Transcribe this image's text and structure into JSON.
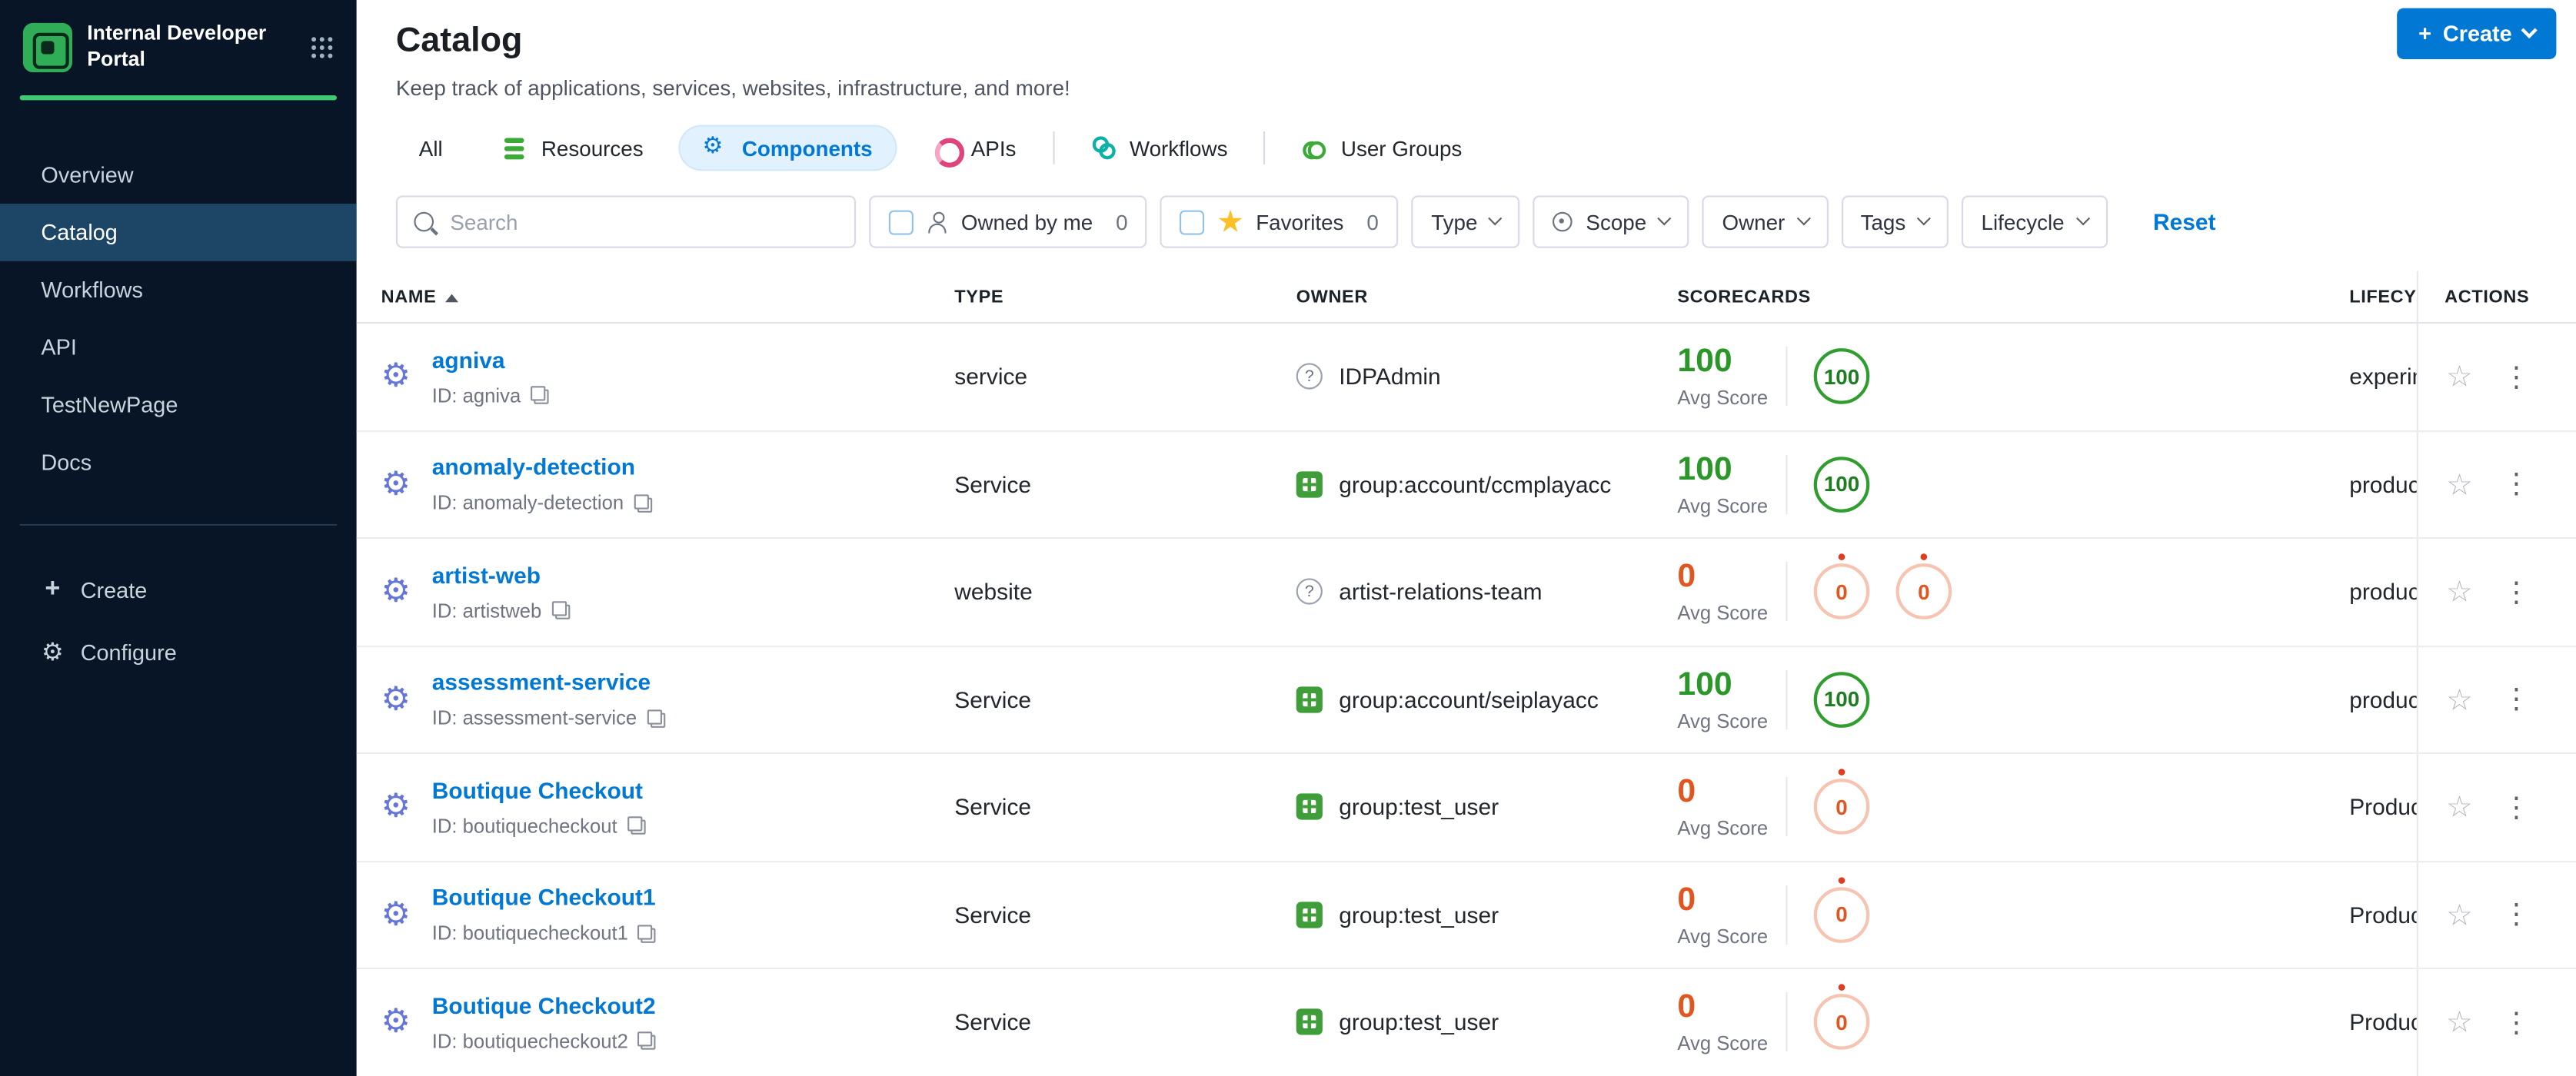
{
  "colors": {
    "accent": "#0278d5",
    "green": "#2b9728",
    "orange": "#e2551e"
  },
  "sidebar": {
    "brand": "Internal Developer Portal",
    "items": [
      {
        "label": "Overview",
        "state": ""
      },
      {
        "label": "Catalog",
        "state": "active"
      },
      {
        "label": "Workflows",
        "state": ""
      },
      {
        "label": "API",
        "state": ""
      },
      {
        "label": "TestNewPage",
        "state": ""
      },
      {
        "label": "Docs",
        "state": ""
      }
    ],
    "create_label": "Create",
    "configure_label": "Configure"
  },
  "header": {
    "title": "Catalog",
    "subtitle": "Keep track of applications, services, websites, infrastructure, and more!",
    "create_button": "Create"
  },
  "tabs": [
    {
      "label": "All",
      "kind": "tab",
      "icon": "none",
      "state": ""
    },
    {
      "label": "Resources",
      "kind": "tab",
      "icon": "resources",
      "state": ""
    },
    {
      "label": "Components",
      "kind": "tab",
      "icon": "components",
      "state": "active"
    },
    {
      "label": "APIs",
      "kind": "tab",
      "icon": "apis",
      "state": ""
    },
    {
      "label": "",
      "kind": "divider",
      "icon": "none",
      "state": ""
    },
    {
      "label": "Workflows",
      "kind": "tab",
      "icon": "workflows",
      "state": ""
    },
    {
      "label": "",
      "kind": "divider",
      "icon": "none",
      "state": ""
    },
    {
      "label": "User Groups",
      "kind": "tab",
      "icon": "groups",
      "state": ""
    }
  ],
  "filters": {
    "search_placeholder": "Search",
    "owned_by_me": {
      "label": "Owned by me",
      "count": "0"
    },
    "favorites": {
      "label": "Favorites",
      "count": "0"
    },
    "dropdowns": [
      {
        "label": "Type",
        "icon": "none"
      },
      {
        "label": "Scope",
        "icon": "scope"
      },
      {
        "label": "Owner",
        "icon": "none"
      },
      {
        "label": "Tags",
        "icon": "none"
      },
      {
        "label": "Lifecycle",
        "icon": "none"
      }
    ],
    "reset_label": "Reset"
  },
  "table": {
    "headers": {
      "name": "NAME",
      "type": "TYPE",
      "owner": "OWNER",
      "scorecards": "SCORECARDS",
      "lifecycle": "LIFECYC",
      "actions": "ACTIONS"
    },
    "avg_label": "Avg Score",
    "rows": [
      {
        "name": "agniva",
        "id": "ID: agniva",
        "type": "service",
        "owner": "IDPAdmin",
        "owner_icon": "q",
        "score": "100",
        "score_tone": "green",
        "badges": [
          {
            "value": "100",
            "tone": "green",
            "dot": false
          }
        ],
        "lifecycle": "experim"
      },
      {
        "name": "anomaly-detection",
        "id": "ID: anomaly-detection",
        "type": "Service",
        "owner": "group:account/ccmplayacc",
        "owner_icon": "grp",
        "score": "100",
        "score_tone": "green",
        "badges": [
          {
            "value": "100",
            "tone": "green",
            "dot": false
          }
        ],
        "lifecycle": "produc"
      },
      {
        "name": "artist-web",
        "id": "ID: artistweb",
        "type": "website",
        "owner": "artist-relations-team",
        "owner_icon": "q",
        "score": "0",
        "score_tone": "orange",
        "badges": [
          {
            "value": "0",
            "tone": "orange",
            "dot": true
          },
          {
            "value": "0",
            "tone": "orange",
            "dot": true
          }
        ],
        "lifecycle": "produc"
      },
      {
        "name": "assessment-service",
        "id": "ID: assessment-service",
        "type": "Service",
        "owner": "group:account/seiplayacc",
        "owner_icon": "grp",
        "score": "100",
        "score_tone": "green",
        "badges": [
          {
            "value": "100",
            "tone": "green",
            "dot": false
          }
        ],
        "lifecycle": "produc"
      },
      {
        "name": "Boutique Checkout",
        "id": "ID: boutiquecheckout",
        "type": "Service",
        "owner": "group:test_user",
        "owner_icon": "grp",
        "score": "0",
        "score_tone": "orange",
        "badges": [
          {
            "value": "0",
            "tone": "orange",
            "dot": true
          }
        ],
        "lifecycle": "Produc"
      },
      {
        "name": "Boutique Checkout1",
        "id": "ID: boutiquecheckout1",
        "type": "Service",
        "owner": "group:test_user",
        "owner_icon": "grp",
        "score": "0",
        "score_tone": "orange",
        "badges": [
          {
            "value": "0",
            "tone": "orange",
            "dot": true
          }
        ],
        "lifecycle": "Produc"
      },
      {
        "name": "Boutique Checkout2",
        "id": "ID: boutiquecheckout2",
        "type": "Service",
        "owner": "group:test_user",
        "owner_icon": "grp",
        "score": "0",
        "score_tone": "orange",
        "badges": [
          {
            "value": "0",
            "tone": "orange",
            "dot": true
          }
        ],
        "lifecycle": "Produc"
      }
    ]
  }
}
